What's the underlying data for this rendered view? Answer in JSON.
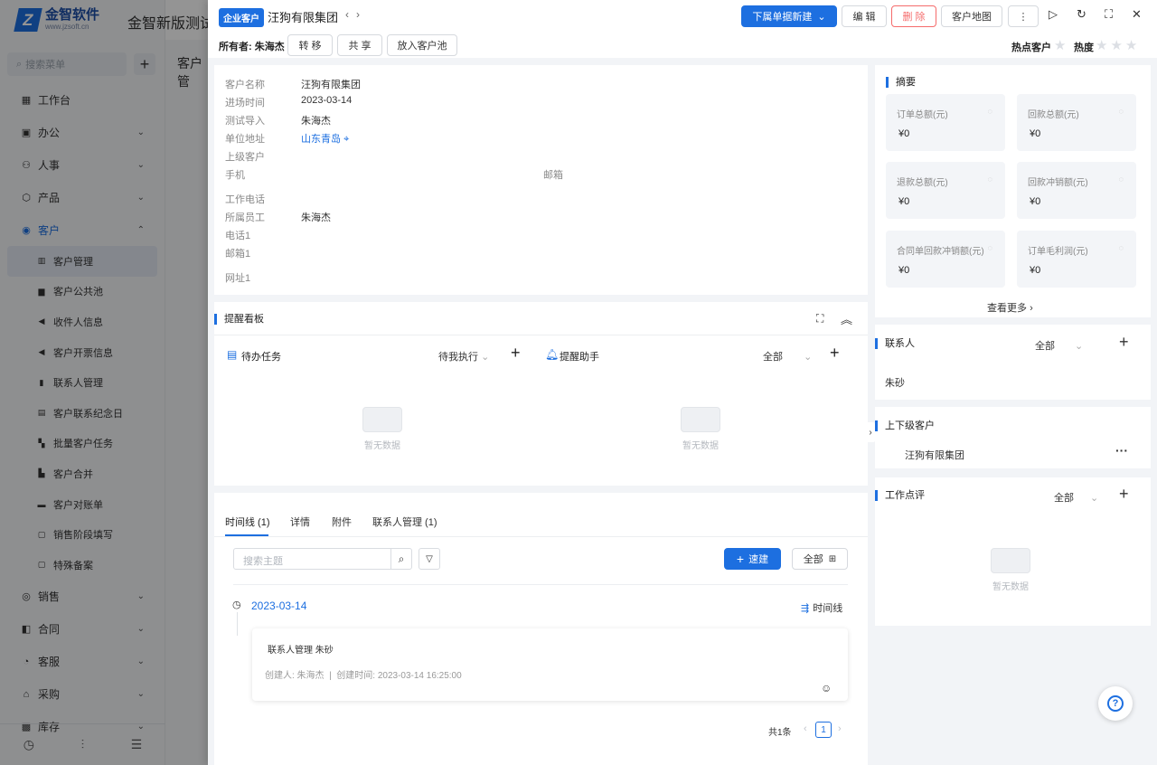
{
  "app": {
    "logo_name": "金智软件",
    "logo_url": "www.jzsoft.cn",
    "title": "金智新版测试公司",
    "search_placeholder": "搜索菜单"
  },
  "sidebar": {
    "items": [
      {
        "label": "工作台",
        "icon": "dashboard-icon"
      },
      {
        "label": "办公",
        "icon": "office-icon"
      },
      {
        "label": "人事",
        "icon": "people-icon"
      },
      {
        "label": "产品",
        "icon": "product-icon"
      },
      {
        "label": "客户",
        "icon": "customer-icon"
      }
    ],
    "sub_items": [
      "客户管理",
      "客户公共池",
      "收件人信息",
      "客户开票信息",
      "联系人管理",
      "客户联系纪念日",
      "批量客户任务",
      "客户合并",
      "客户对账单",
      "销售阶段填写",
      "特殊备案"
    ],
    "bottom_items": [
      {
        "label": "销售",
        "icon": "sales-icon"
      },
      {
        "label": "合同",
        "icon": "contract-icon"
      },
      {
        "label": "客服",
        "icon": "service-icon"
      },
      {
        "label": "采购",
        "icon": "purchase-icon"
      },
      {
        "label": "库存",
        "icon": "stock-icon"
      }
    ]
  },
  "main_bg": {
    "title": "客户管"
  },
  "drawer": {
    "tag": "企业客户",
    "name": "汪狗有限集团",
    "owner_label": "所有者:",
    "owner": "朱海杰",
    "btn_transfer": "转 移",
    "btn_share": "共 享",
    "btn_pool": "放入客户池",
    "btn_new": "下属单据新建",
    "btn_edit": "编 辑",
    "btn_delete": "删 除",
    "btn_map": "客户地图",
    "hot_customer": "热点客户",
    "hotness": "热度",
    "hotness_stars": 0
  },
  "info": {
    "fields": [
      {
        "label": "客户名称",
        "value": "汪狗有限集团"
      },
      {
        "label": "进场时间",
        "value": "2023-03-14"
      },
      {
        "label": "测试导入",
        "value": "朱海杰"
      },
      {
        "label": "单位地址",
        "value": "山东青岛"
      },
      {
        "label": "上级客户",
        "value": ""
      },
      {
        "label": "手机",
        "value": ""
      },
      {
        "label": "工作电话",
        "value": ""
      },
      {
        "label": "所属员工",
        "value": "朱海杰"
      },
      {
        "label": "电话1",
        "value": ""
      },
      {
        "label": "邮箱1",
        "value": ""
      },
      {
        "label": "网址1",
        "value": ""
      }
    ],
    "email_label": "邮箱"
  },
  "reminder": {
    "title": "提醒看板",
    "todo_title": "待办任务",
    "todo_filter": "待我执行",
    "assistant_title": "提醒助手",
    "assistant_filter": "全部",
    "empty": "暂无数据"
  },
  "timeline": {
    "tabs": [
      "时间线 (1)",
      "详情",
      "附件",
      "联系人管理 (1)"
    ],
    "search_placeholder": "搜索主题",
    "quick_new": "速建",
    "all": "全部",
    "date": "2023-03-14",
    "mode": "时间线",
    "entry_title": "联系人管理 朱砂",
    "entry_meta": "创建人: 朱海杰  |  创建时间: 2023-03-14 16:25:00",
    "total": "共1条",
    "page": "1"
  },
  "summary": {
    "title": "摘要",
    "items": [
      {
        "label": "订单总额(元)",
        "value": "¥0"
      },
      {
        "label": "回款总额(元)",
        "value": "¥0"
      },
      {
        "label": "退款总额(元)",
        "value": "¥0"
      },
      {
        "label": "回款冲销额(元)",
        "value": "¥0"
      },
      {
        "label": "合同单回款冲销额(元)",
        "value": "¥0"
      },
      {
        "label": "订单毛利润(元)",
        "value": "¥0"
      }
    ],
    "more": "查看更多"
  },
  "contacts": {
    "title": "联系人",
    "filter": "全部",
    "item": "朱砂"
  },
  "hierarchy": {
    "title": "上下级客户",
    "item": "汪狗有限集团"
  },
  "reviews": {
    "title": "工作点评",
    "filter": "全部",
    "empty": "暂无数据"
  },
  "colors": {
    "accent": "#1d6fe0",
    "danger": "#f56c6c"
  }
}
